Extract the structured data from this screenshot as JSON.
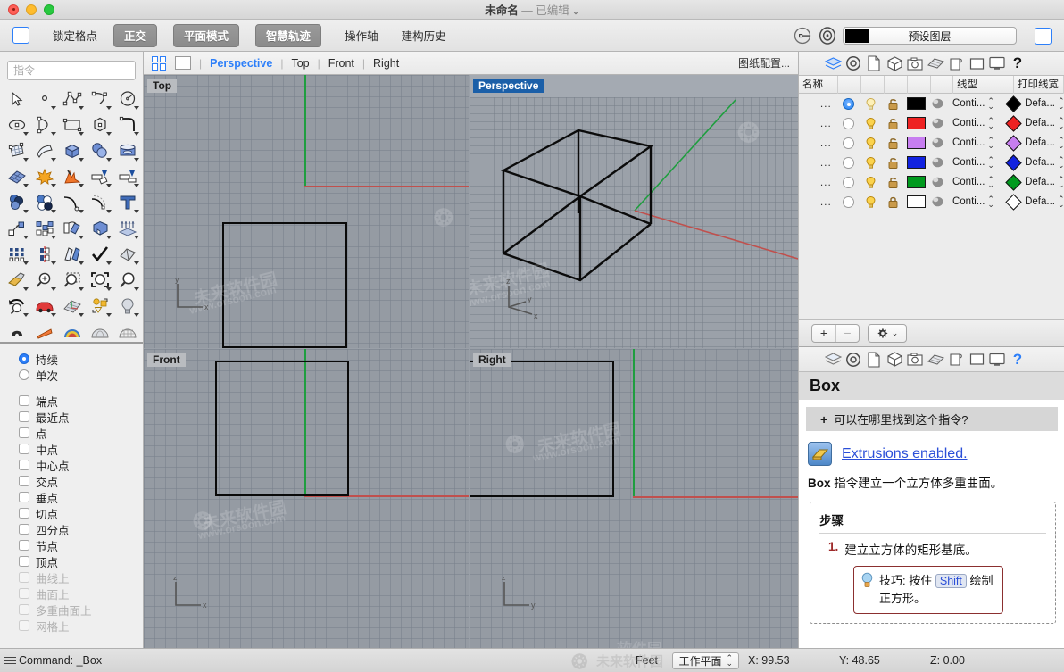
{
  "titlebar": {
    "name": "未命名",
    "dash": "—",
    "edited": "已编辑"
  },
  "toolbar": {
    "lock_grid": "锁定格点",
    "ortho": "正交",
    "planar": "平面模式",
    "smart_track": "智慧轨迹",
    "gumball": "操作轴",
    "history": "建构历史",
    "layer_select": "预设图层",
    "layer_color": "#000000"
  },
  "sidebar": {
    "command_placeholder": "指令",
    "osnap_modes": [
      {
        "label": "持续",
        "type": "radio",
        "checked": true
      },
      {
        "label": "单次",
        "type": "radio",
        "checked": false
      }
    ],
    "osnap_items": [
      {
        "label": "端点",
        "checked": false,
        "enabled": true
      },
      {
        "label": "最近点",
        "checked": false,
        "enabled": true
      },
      {
        "label": "点",
        "checked": false,
        "enabled": true
      },
      {
        "label": "中点",
        "checked": false,
        "enabled": true
      },
      {
        "label": "中心点",
        "checked": false,
        "enabled": true
      },
      {
        "label": "交点",
        "checked": false,
        "enabled": true
      },
      {
        "label": "垂点",
        "checked": false,
        "enabled": true
      },
      {
        "label": "切点",
        "checked": false,
        "enabled": true
      },
      {
        "label": "四分点",
        "checked": false,
        "enabled": true
      },
      {
        "label": "节点",
        "checked": false,
        "enabled": true
      },
      {
        "label": "顶点",
        "checked": false,
        "enabled": true
      },
      {
        "label": "曲线上",
        "checked": false,
        "enabled": false
      },
      {
        "label": "曲面上",
        "checked": false,
        "enabled": false
      },
      {
        "label": "多重曲面上",
        "checked": false,
        "enabled": false
      },
      {
        "label": "网格上",
        "checked": false,
        "enabled": false
      }
    ]
  },
  "viewport_tabs": {
    "items": [
      {
        "label": "Perspective",
        "active": true
      },
      {
        "label": "Top",
        "active": false
      },
      {
        "label": "Front",
        "active": false
      },
      {
        "label": "Right",
        "active": false
      }
    ],
    "config": "图纸配置..."
  },
  "viewports": [
    {
      "label": "Top",
      "active": false
    },
    {
      "label": "Perspective",
      "active": true
    },
    {
      "label": "Front",
      "active": false
    },
    {
      "label": "Right",
      "active": false
    }
  ],
  "axis_labels": {
    "top": [
      "y",
      "x"
    ],
    "perspective": [
      "z",
      "y",
      "x"
    ],
    "front": [
      "z",
      "x"
    ],
    "right": [
      "z",
      "y"
    ]
  },
  "layers": {
    "headers": [
      "名称",
      "",
      "",
      "",
      "",
      "",
      "线型",
      "",
      "打印线宽"
    ],
    "rows": [
      {
        "name": "...",
        "current": true,
        "on": true,
        "locked": false,
        "color": "#000000",
        "linetype": "Conti...",
        "printwidth": "Defa...",
        "pw_color": "#000000"
      },
      {
        "name": "...",
        "current": false,
        "on": true,
        "locked": false,
        "color": "#ee2222",
        "linetype": "Conti...",
        "printwidth": "Defa...",
        "pw_color": "#ee2222"
      },
      {
        "name": "...",
        "current": false,
        "on": true,
        "locked": false,
        "color": "#c77ef0",
        "linetype": "Conti...",
        "printwidth": "Defa...",
        "pw_color": "#c77ef0"
      },
      {
        "name": "...",
        "current": false,
        "on": true,
        "locked": false,
        "color": "#1122e0",
        "linetype": "Conti...",
        "printwidth": "Defa...",
        "pw_color": "#1122e0"
      },
      {
        "name": "...",
        "current": false,
        "on": true,
        "locked": false,
        "color": "#009a1e",
        "linetype": "Conti...",
        "printwidth": "Defa...",
        "pw_color": "#009a1e"
      },
      {
        "name": "...",
        "current": false,
        "on": true,
        "locked": true,
        "color": "#ffffff",
        "linetype": "Conti...",
        "printwidth": "Defa...",
        "pw_color": "#ffffff"
      }
    ],
    "add_label": "+",
    "remove_label": "−"
  },
  "help": {
    "title": "Box",
    "find_command": "可以在哪里找到这个指令?",
    "find_plus": "+",
    "extrusions": "Extrusions enabled.",
    "desc_bold": "Box",
    "desc_rest": " 指令建立一个立方体多重曲面。",
    "steps_title": "步骤",
    "step1_num": "1.",
    "step1_text": "建立立方体的矩形基底。",
    "tip_prefix": "技巧: 按住",
    "tip_key": "Shift",
    "tip_suffix": "绘制正方形。"
  },
  "statusbar": {
    "command": "Command: _Box",
    "unit": "Feet",
    "cplane": "工作平面",
    "x": "X: 99.53",
    "y": "Y: 48.65",
    "z": "Z: 0.00"
  }
}
